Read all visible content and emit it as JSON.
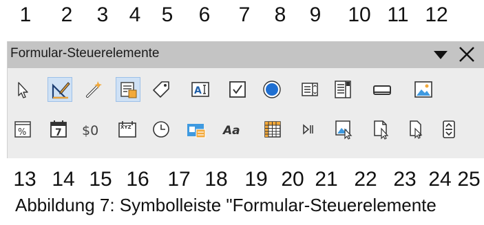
{
  "top_numbers": [
    "1",
    "2",
    "3",
    "4",
    "5",
    "6",
    "7",
    "8",
    "9",
    "10",
    "11",
    "12"
  ],
  "bottom_numbers": [
    "13",
    "14",
    "15",
    "16",
    "17",
    "18",
    "19",
    "20",
    "21",
    "22",
    "23",
    "24",
    "25"
  ],
  "toolbar": {
    "title": "Formular-Steuerelemente",
    "menu_icon": "dropdown-triangle-icon",
    "close_icon": "close-icon",
    "row1": [
      {
        "icon": "select-pointer-icon",
        "active": false
      },
      {
        "icon": "design-mode-icon",
        "active": true
      },
      {
        "icon": "control-wizards-icon",
        "active": false
      },
      {
        "icon": "form-design-icon",
        "active": true
      },
      {
        "icon": "label-tag-icon",
        "active": false
      },
      {
        "icon": "text-box-icon",
        "active": false
      },
      {
        "icon": "check-box-icon",
        "active": false
      },
      {
        "icon": "option-button-icon",
        "active": false
      },
      {
        "icon": "list-box-icon",
        "active": false
      },
      {
        "icon": "combo-box-icon",
        "active": false
      },
      {
        "icon": "push-button-icon",
        "active": false
      },
      {
        "icon": "image-button-icon",
        "active": false
      }
    ],
    "row2": [
      {
        "icon": "formatted-field-icon",
        "text": "%"
      },
      {
        "icon": "date-field-icon",
        "text": "7"
      },
      {
        "icon": "currency-field-icon",
        "text": "$0"
      },
      {
        "icon": "pattern-field-icon",
        "text": "XYZ"
      },
      {
        "icon": "time-field-icon"
      },
      {
        "icon": "group-box-icon"
      },
      {
        "icon": "text-formatting-icon",
        "text": "Aa"
      },
      {
        "icon": "table-control-icon"
      },
      {
        "icon": "navigation-bar-icon"
      },
      {
        "icon": "image-control-icon"
      },
      {
        "icon": "file-selection-icon"
      },
      {
        "icon": "spin-button-icon"
      },
      {
        "icon": "scroll-bar-icon"
      }
    ]
  },
  "caption": "Abbildung 7: Symbolleiste \"Formular-Steuerelemente"
}
